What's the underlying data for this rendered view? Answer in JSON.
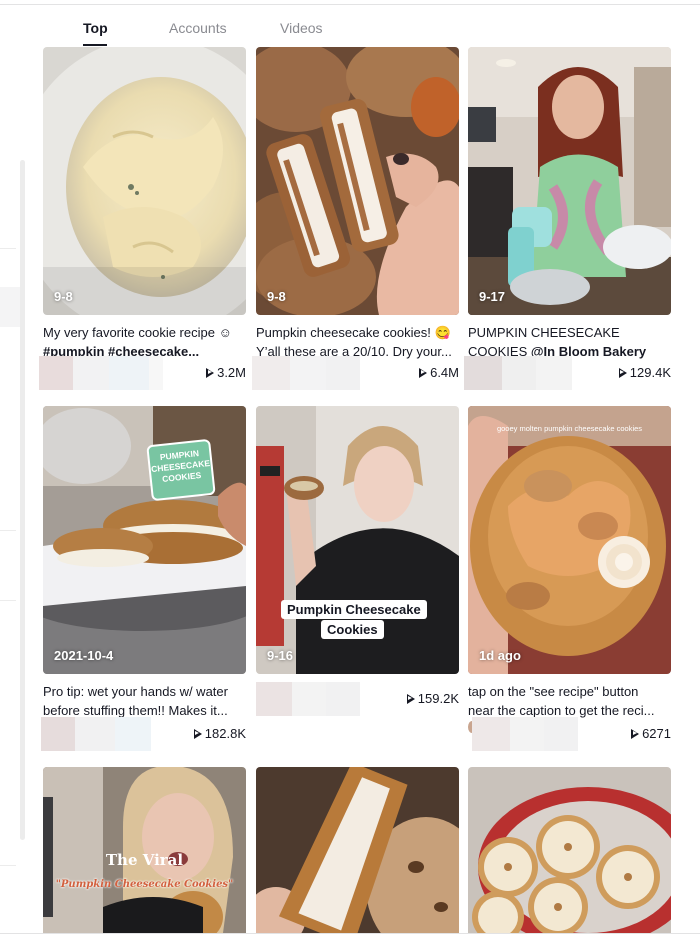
{
  "tabs": [
    {
      "label": "Top",
      "active": true
    },
    {
      "label": "Accounts",
      "active": false
    },
    {
      "label": "Videos",
      "active": false
    }
  ],
  "icons": {
    "views": "play-icon"
  },
  "colors": {
    "text": "#161823",
    "tab_inactive": "#8a8b91",
    "sticker_green": "#79c5a2"
  },
  "videos": [
    {
      "date": "9-8",
      "desc_line1": "My very favorite cookie recipe ☺",
      "desc_line2": "#pumpkin #cheesecake...",
      "views": "3.2M"
    },
    {
      "date": "9-8",
      "desc_line1": "Pumpkin cheesecake cookies! 😋",
      "desc_line2": "Y’all these are a 20/10. Dry your...",
      "views": "6.4M"
    },
    {
      "date": "9-17",
      "desc_line1": "PUMPKIN CHEESECAKE",
      "desc_line2_prefix": "COOKIES ",
      "desc_line2_bold": "@In Bloom Bakery",
      "views": "129.4K"
    },
    {
      "date": "2021-10-4",
      "desc_line1": "Pro tip: wet your hands w/ water",
      "desc_line2": "before stuffing them!! Makes it...",
      "views": "182.8K",
      "sticker": [
        "PUMPKIN",
        "CHEESECAKE",
        "COOKIES"
      ]
    },
    {
      "date": "9-16",
      "desc_line1": "",
      "desc_line2": "",
      "views": "159.2K",
      "caption_line1": "Pumpkin Cheesecake",
      "caption_line2": "Cookies"
    },
    {
      "date": "1d ago",
      "desc_line1": "tap on the \"see recipe\" button",
      "desc_line2": "near the caption to get the reci...",
      "views": "6271",
      "overlay_text": "gooey molten pumpkin cheesecake cookies"
    },
    {
      "date": "",
      "overlay_title": "The Viral",
      "overlay_sub": "\"Pumpkin Cheesecake Cookies\""
    },
    {
      "date": ""
    },
    {
      "date": ""
    }
  ]
}
